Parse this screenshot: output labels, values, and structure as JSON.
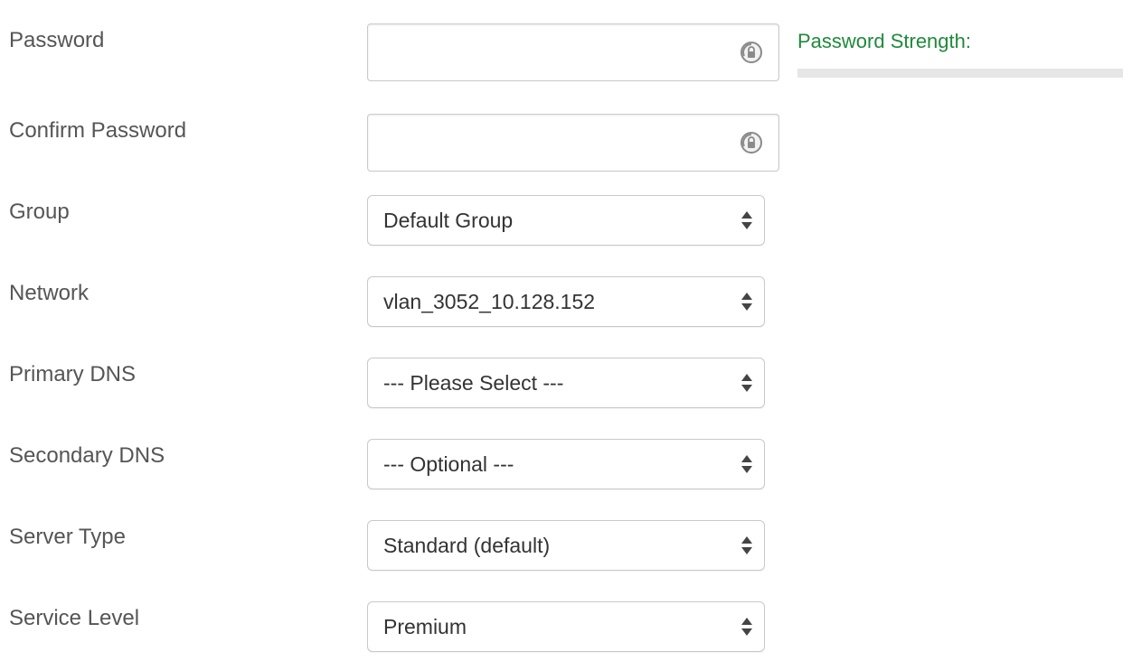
{
  "password": {
    "label": "Password",
    "value": "",
    "strength_label": "Password Strength:",
    "strength": 0
  },
  "confirm_password": {
    "label": "Confirm Password",
    "value": ""
  },
  "group": {
    "label": "Group",
    "selected": "Default Group"
  },
  "network": {
    "label": "Network",
    "selected": "vlan_3052_10.128.152"
  },
  "primary_dns": {
    "label": "Primary DNS",
    "selected": "--- Please Select ---"
  },
  "secondary_dns": {
    "label": "Secondary DNS",
    "selected": "--- Optional ---"
  },
  "server_type": {
    "label": "Server Type",
    "selected": "Standard (default)"
  },
  "service_level": {
    "label": "Service Level",
    "selected": "Premium"
  },
  "colors": {
    "label_text": "#555555",
    "strength_text": "#1e8a3a",
    "strength_track": "#e6e6e6",
    "border": "#c9c9c9"
  },
  "icons": {
    "password_field": "key-lock-icon",
    "select_arrows": "up-down-arrows-icon"
  }
}
